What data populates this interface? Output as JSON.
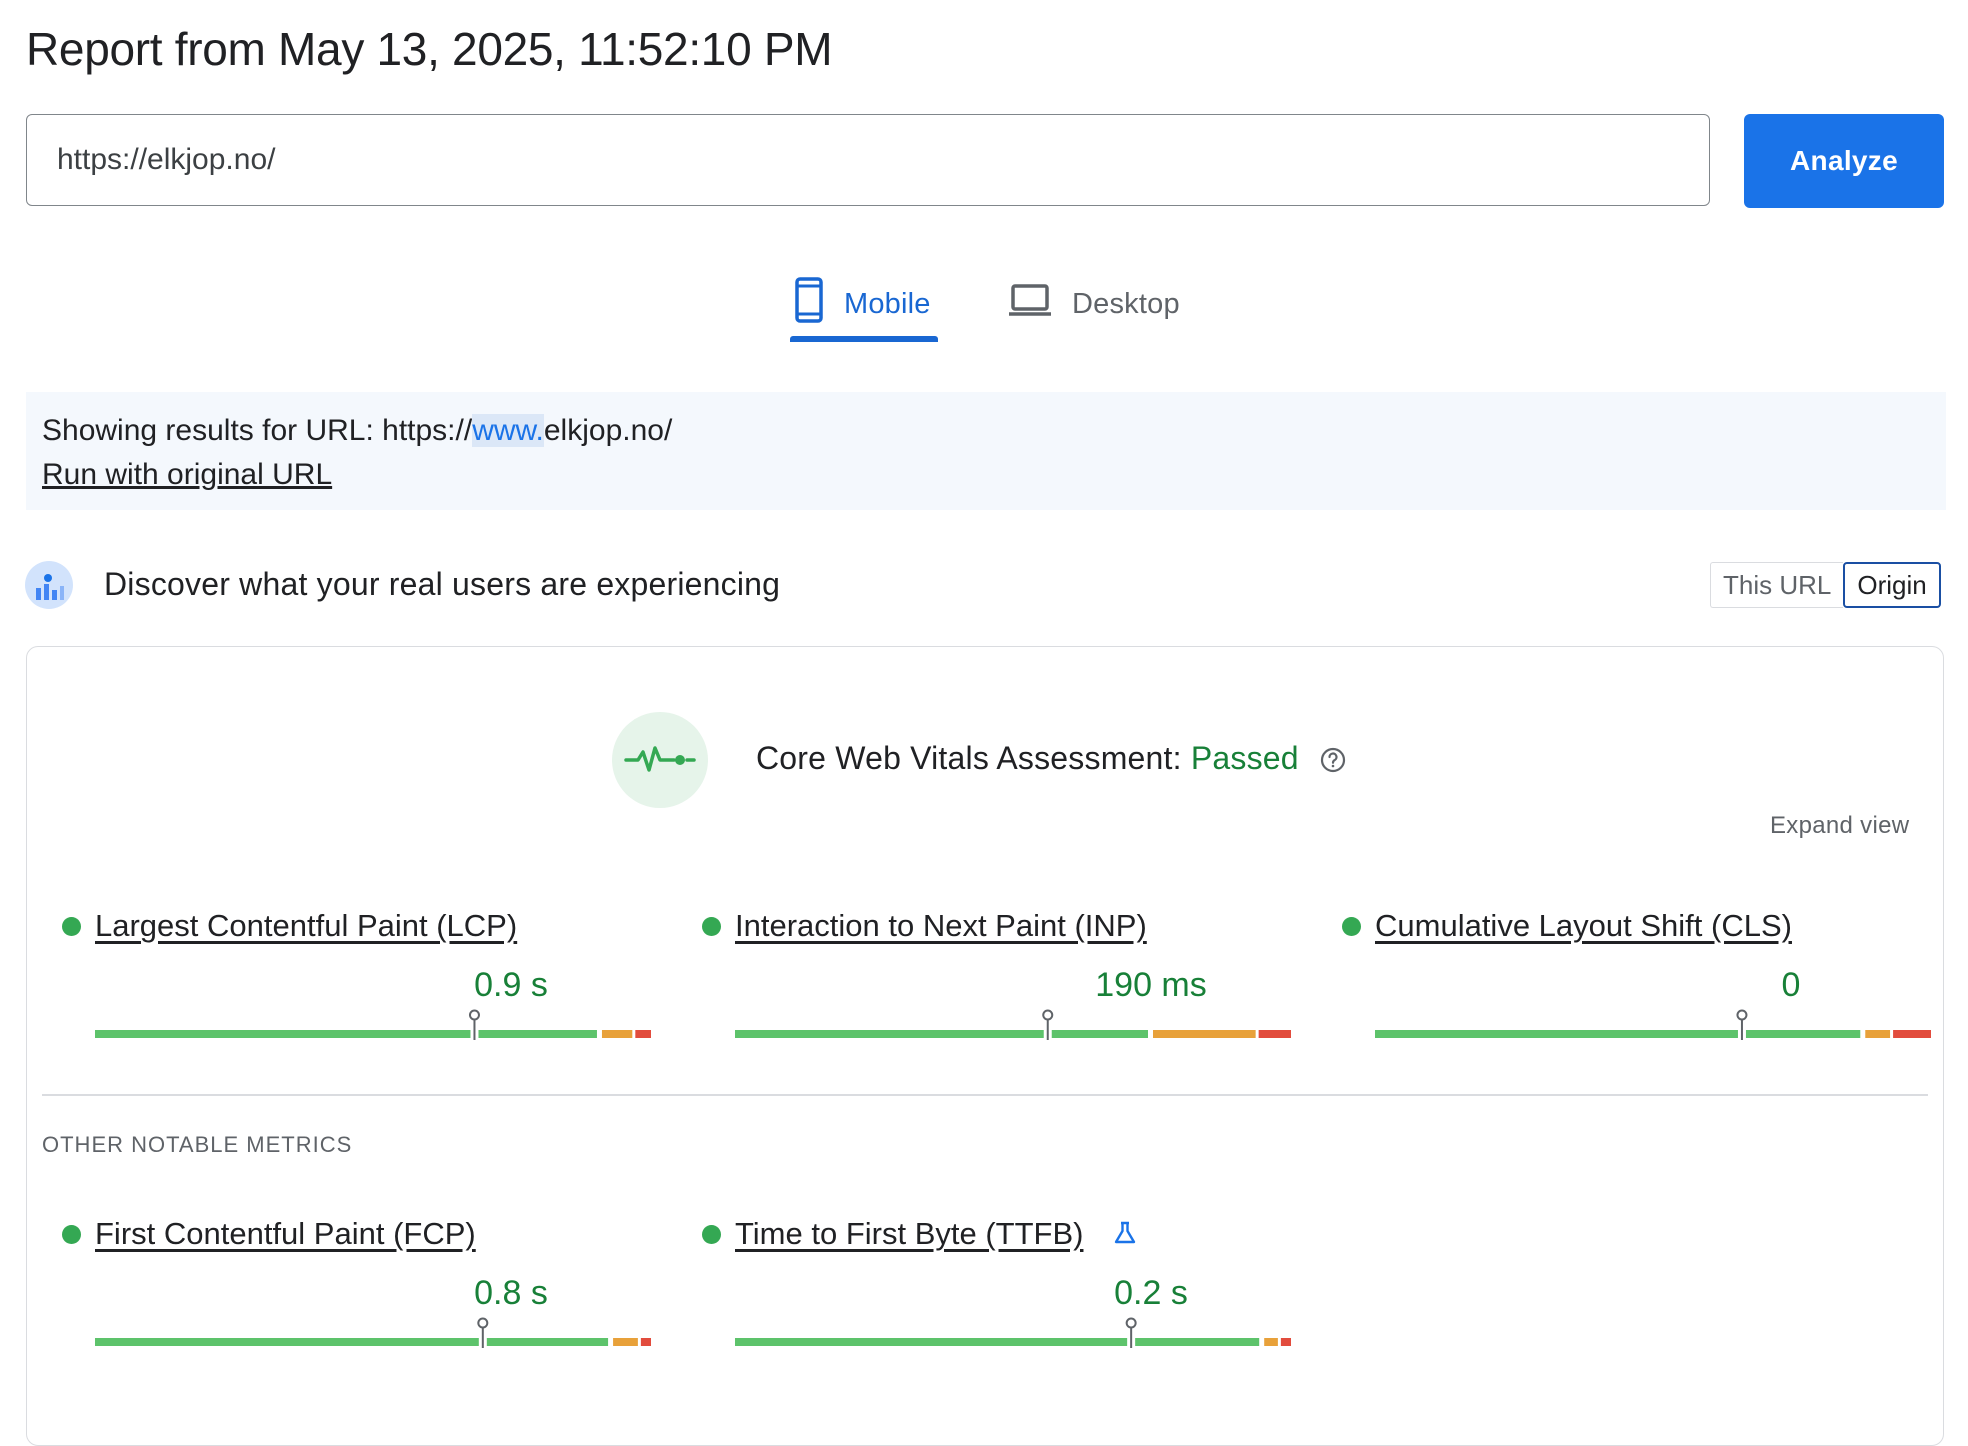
{
  "report": {
    "title": "Report from May 13, 2025, 11:52:10 PM"
  },
  "search": {
    "url_value": "https://elkjop.no/",
    "analyze_label": "Analyze"
  },
  "tabs": [
    {
      "label": "Mobile",
      "icon": "smartphone-icon",
      "active": true
    },
    {
      "label": "Desktop",
      "icon": "laptop-icon",
      "active": false
    }
  ],
  "notice": {
    "prefix": "Showing results for URL: https://",
    "highlight": "www.",
    "suffix": "elkjop.no/",
    "link_label": "Run with original URL"
  },
  "field_data": {
    "heading": "Discover what your real users are experiencing",
    "toggle": {
      "this_url": "This URL",
      "origin": "Origin",
      "selected": "Origin"
    }
  },
  "assessment": {
    "label": "Core Web Vitals Assessment: ",
    "status": "Passed",
    "expand_label": "Expand view"
  },
  "core_metrics": [
    {
      "name": "Largest Contentful Paint (LCP)",
      "value": "0.9 s",
      "status": "good",
      "distribution": {
        "good": 0.91,
        "needs_improvement": 0.06,
        "poor": 0.03
      },
      "marker": 0.75
    },
    {
      "name": "Interaction to Next Paint (INP)",
      "value": "190 ms",
      "status": "good",
      "distribution": {
        "good": 0.75,
        "needs_improvement": 0.19,
        "poor": 0.06
      },
      "marker": 0.75
    },
    {
      "name": "Cumulative Layout Shift (CLS)",
      "value": "0",
      "status": "good",
      "distribution": {
        "good": 0.88,
        "needs_improvement": 0.05,
        "poor": 0.07
      },
      "marker": 0.75
    }
  ],
  "other_metrics": {
    "heading": "OTHER NOTABLE METRICS",
    "items": [
      {
        "name": "First Contentful Paint (FCP)",
        "value": "0.8 s",
        "status": "good",
        "distribution": {
          "good": 0.93,
          "needs_improvement": 0.05,
          "poor": 0.02
        },
        "marker": 0.75
      },
      {
        "name": "Time to First Byte (TTFB)",
        "value": "0.2 s",
        "status": "good",
        "experimental": true,
        "distribution": {
          "good": 0.95,
          "needs_improvement": 0.03,
          "poor": 0.02
        },
        "marker": 0.75
      }
    ]
  },
  "colors": {
    "accent": "#1a73e8",
    "good": "#34a853",
    "good_bar": "#5dc36b",
    "needs_improvement": "#e8a13a",
    "poor": "#e24c3d",
    "good_text": "#188038"
  }
}
